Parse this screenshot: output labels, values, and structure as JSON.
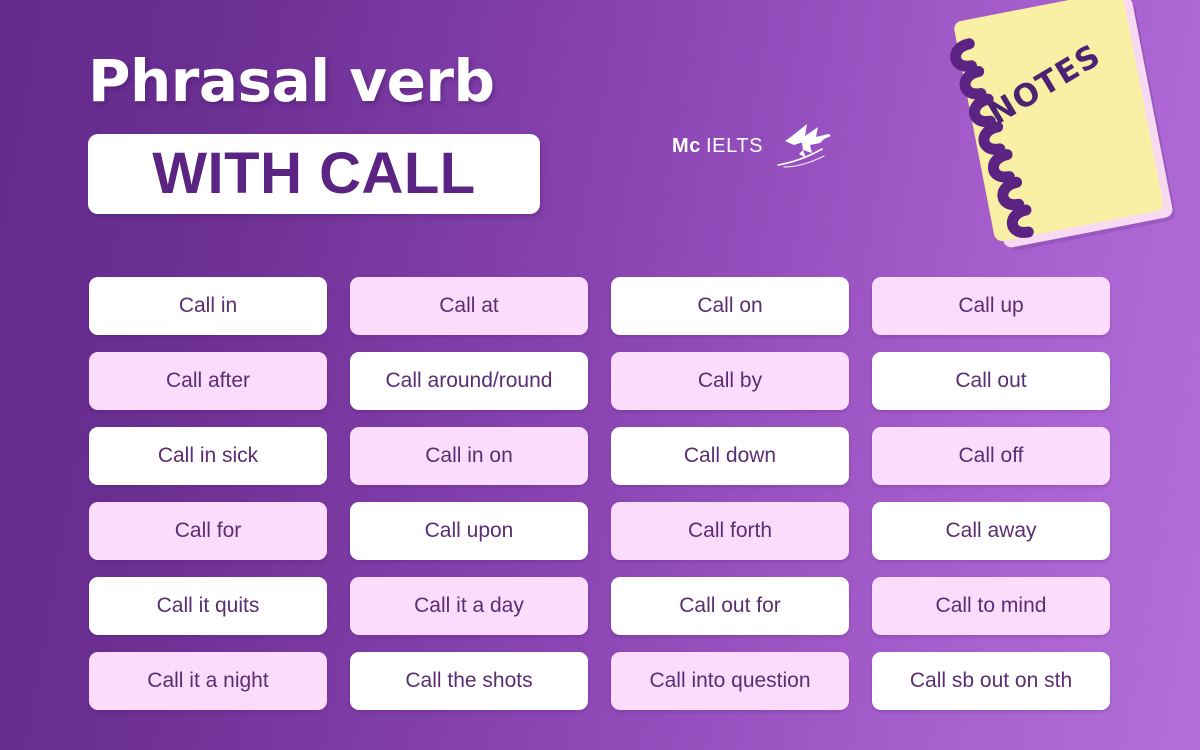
{
  "header": {
    "title_line1": "Phrasal verb",
    "title_line2": "WITH CALL",
    "logo": {
      "brand_prefix": "Mc",
      "brand_name": "IELTS",
      "bird_icon": "hummingbird-icon"
    },
    "notebook": {
      "label": "NOTES",
      "cover_color": "#faf0a5",
      "spiral_color": "#5b2382"
    }
  },
  "colors": {
    "background_start": "#632a8c",
    "background_end": "#b36fd9",
    "card_white": "#ffffff",
    "card_pink": "#fbdcfd",
    "card_text": "#5b2d72",
    "title_box_text": "#5b2382"
  },
  "grid": {
    "columns": 4,
    "rows": 6,
    "cards": [
      {
        "label": "Call in",
        "style": "white"
      },
      {
        "label": "Call at",
        "style": "pink"
      },
      {
        "label": "Call on",
        "style": "white"
      },
      {
        "label": "Call up",
        "style": "pink"
      },
      {
        "label": "Call after",
        "style": "pink"
      },
      {
        "label": "Call around/round",
        "style": "white"
      },
      {
        "label": "Call by",
        "style": "pink"
      },
      {
        "label": "Call out",
        "style": "white"
      },
      {
        "label": "Call in sick",
        "style": "white"
      },
      {
        "label": "Call in on",
        "style": "pink"
      },
      {
        "label": "Call down",
        "style": "white"
      },
      {
        "label": "Call off",
        "style": "pink"
      },
      {
        "label": "Call for",
        "style": "pink"
      },
      {
        "label": "Call upon",
        "style": "white"
      },
      {
        "label": "Call forth",
        "style": "pink"
      },
      {
        "label": "Call away",
        "style": "white"
      },
      {
        "label": "Call it quits",
        "style": "white"
      },
      {
        "label": "Call it a day",
        "style": "pink"
      },
      {
        "label": "Call out for",
        "style": "white"
      },
      {
        "label": "Call to mind",
        "style": "pink"
      },
      {
        "label": "Call it a night",
        "style": "pink"
      },
      {
        "label": "Call the shots",
        "style": "white"
      },
      {
        "label": "Call into question",
        "style": "pink"
      },
      {
        "label": "Call sb out on sth",
        "style": "white"
      }
    ]
  }
}
